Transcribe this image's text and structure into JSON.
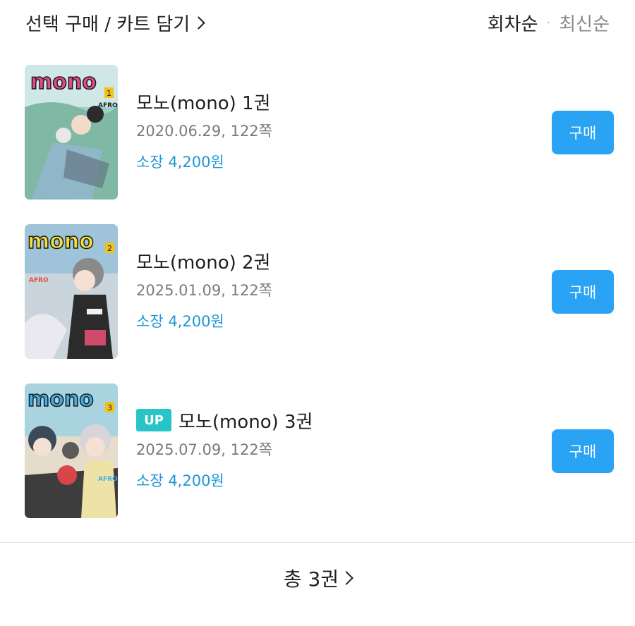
{
  "header": {
    "select_buy_label": "선택 구매 / 카트 담기",
    "sort_active": "회차순",
    "sort_separator": "·",
    "sort_inactive": "최신순"
  },
  "items": [
    {
      "title": "모노(mono) 1권",
      "date_pages": "2020.06.29, 122쪽",
      "price": "소장 4,200원",
      "buy_label": "구매",
      "badge": "",
      "cover_logo": "mono",
      "cover_volume": "1",
      "cover_author": "AFRO"
    },
    {
      "title": "모노(mono) 2권",
      "date_pages": "2025.01.09, 122쪽",
      "price": "소장 4,200원",
      "buy_label": "구매",
      "badge": "",
      "cover_logo": "mono",
      "cover_volume": "2",
      "cover_author": "AFRO"
    },
    {
      "title": "모노(mono) 3권",
      "date_pages": "2025.07.09, 122쪽",
      "price": "소장 4,200원",
      "buy_label": "구매",
      "badge": "UP",
      "cover_logo": "mono",
      "cover_volume": "3",
      "cover_author": "AFRO"
    }
  ],
  "footer": {
    "total_label": "총 3권"
  },
  "colors": {
    "accent_blue": "#2ba3f5",
    "price_blue": "#2196d3",
    "up_badge": "#27c5c7"
  },
  "icons": {
    "header_arrow": "chevron-right-icon",
    "footer_arrow": "chevron-right-icon"
  }
}
